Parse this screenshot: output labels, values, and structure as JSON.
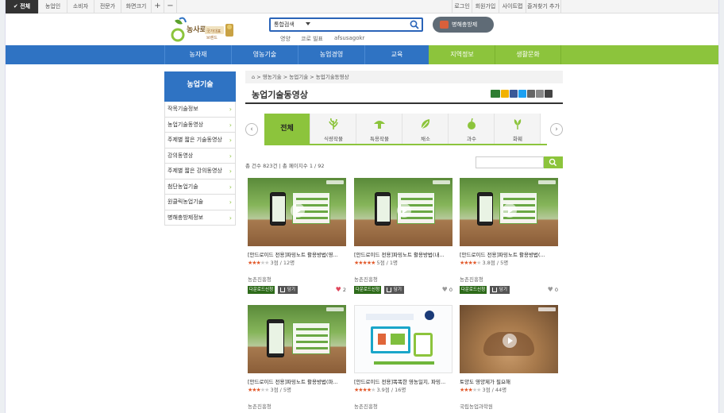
{
  "topbar": {
    "left": [
      "전체",
      "농업인",
      "소비자",
      "전문가"
    ],
    "zoom_label": "화면크기",
    "zoom_plus": "+",
    "zoom_minus": "−",
    "right": [
      "로그인",
      "회원가입",
      "사이트맵",
      "즐겨찾기 추가"
    ]
  },
  "logo": {
    "alt": "농사로 국가대표 브랜드"
  },
  "search": {
    "scope": "통합검색",
    "value": "",
    "keywords": [
      "영양",
      "코로 빌표",
      "afsusagokr"
    ]
  },
  "pest_button": "병해충방제",
  "nav": [
    "농자재",
    "영농기술",
    "농업경영",
    "교육",
    "지역정보",
    "생활문화"
  ],
  "sidebar": {
    "title": "농업기술",
    "items": [
      "작목기술정보",
      "농업기술동영상",
      "주제별 짧은 기술동영상",
      "강의동영상",
      "주제별 짧은 강의동영상",
      "첨단농업기술",
      "원클릭농업기술",
      "병해충방제정보"
    ]
  },
  "breadcrumb": [
    "영농기술",
    "농업기술",
    "농업기술동영상"
  ],
  "page_title": "농업기술동영상",
  "category_tabs": [
    {
      "label": "전체",
      "icon": "all"
    },
    {
      "label": "식량작물",
      "icon": "grain-icon"
    },
    {
      "label": "특용작물",
      "icon": "mushroom-icon"
    },
    {
      "label": "채소",
      "icon": "leaf-icon"
    },
    {
      "label": "과수",
      "icon": "apple-icon"
    },
    {
      "label": "화훼",
      "icon": "flower-icon"
    }
  ],
  "count_text": "총 건수 823건 | 총 페이지수 1 / 92",
  "cards": [
    {
      "title": "[안드로이드 전용]파밍노트 활용방법(영...",
      "rating": "3점 / 12명",
      "stars": 3,
      "org": "농촌진흥청",
      "download": "다운로드신청",
      "save": "담기",
      "likes": "2",
      "liked": true,
      "thumb": "green"
    },
    {
      "title": "[안드로이드 전용]파밍노트 활용방법(내...",
      "rating": "5점 / 1명",
      "stars": 5,
      "org": "농촌진흥청",
      "download": "다운로드신청",
      "save": "담기",
      "likes": "0",
      "liked": false,
      "thumb": "green"
    },
    {
      "title": "[안드로이드 전용]파밍노트 활용방법(...",
      "rating": "3.8점 / 5명",
      "stars": 4,
      "org": "농촌진흥청",
      "download": "다운로드신청",
      "save": "담기",
      "likes": "0",
      "liked": false,
      "thumb": "green"
    },
    {
      "title": "[안드로이드 전용]파밍노트 활용방법(파...",
      "rating": "3점 / 5명",
      "stars": 3,
      "org": "농촌진흥청",
      "thumb": "green"
    },
    {
      "title": "[안드로이드 전용]똑똑한 영농일지, 파밍...",
      "rating": "3.9점 / 16명",
      "stars": 4,
      "org": "농촌진흥청",
      "thumb": "white"
    },
    {
      "title": "토양도 영양제가 필요해",
      "rating": "3점 / 44명",
      "stars": 3,
      "org": "국립농업과학원",
      "thumb": "soil"
    }
  ],
  "colors": {
    "blue": "#2f73c3",
    "green": "#8cc43c",
    "dark_green": "#2e6b1a"
  }
}
